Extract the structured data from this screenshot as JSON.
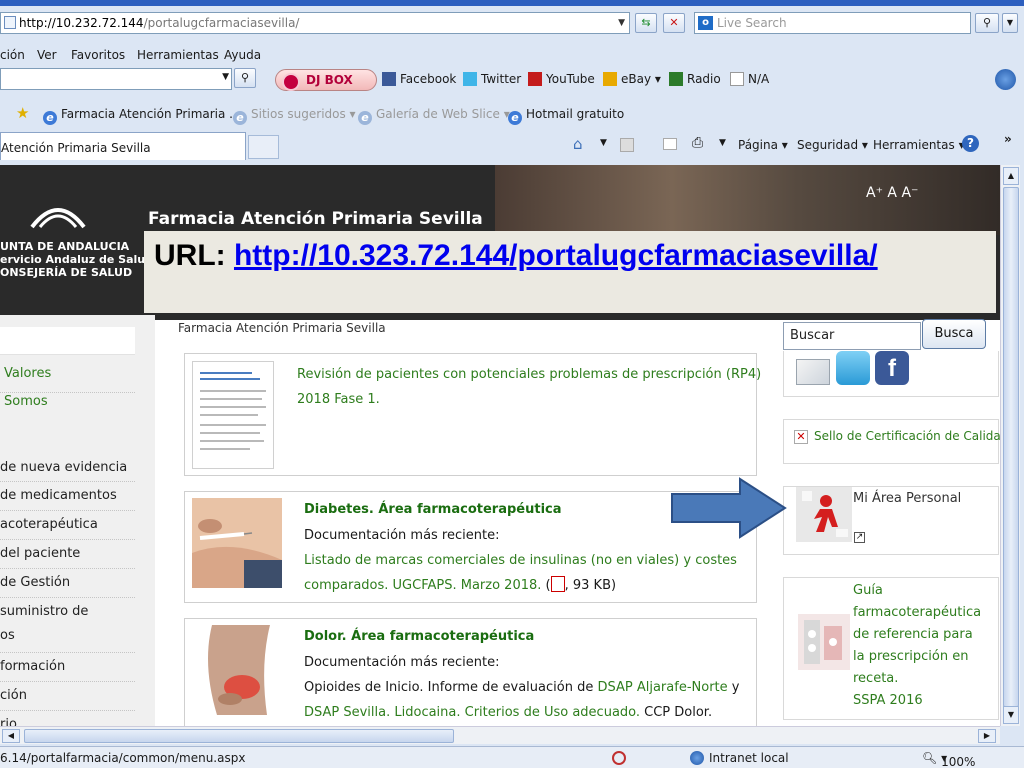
{
  "browser": {
    "address_host": "http://10.232.72.144",
    "address_path": "/portalugcfarmaciasevilla/",
    "live_search_placeholder": "Live Search",
    "menu": [
      "ción",
      "Ver",
      "Favoritos",
      "Herramientas",
      "Ayuda"
    ],
    "toolbar": {
      "djbox": "DJ BOX",
      "facebook": "Facebook",
      "twitter": "Twitter",
      "youtube": "YouTube",
      "ebay": "eBay",
      "radio": "Radio",
      "na": "N/A"
    },
    "favorites": [
      "Farmacia Atención Primaria ...",
      "Sitios sugeridos",
      "Galería de Web Slice",
      "Hotmail gratuito"
    ],
    "tab_title": "Atención Primaria Sevilla",
    "commands": [
      "Página",
      "Seguridad",
      "Herramientas"
    ],
    "status_url": "6.14/portalfarmacia/common/menu.aspx",
    "status_zone": "Intranet local",
    "status_zoom": "100%"
  },
  "banner": {
    "junta_lines": [
      "UNTA DE ANDALUCIA",
      "ervicio Andaluz de Salud",
      "ONSEJERÍA DE SALUD"
    ],
    "title": "Farmacia Atención Primaria Sevilla",
    "font_controls": "A⁺ A A⁻"
  },
  "overlay": {
    "label": "URL: ",
    "url": "http://10.323.72.144/portalugcfarmaciasevilla/"
  },
  "left_menu": {
    "items": [
      "Valores",
      "Somos",
      "de nueva evidencia",
      "de medicamentos",
      "acoterapéutica",
      "del paciente",
      "de Gestión",
      "suministro de",
      "os",
      "formación",
      "ción",
      "rio"
    ]
  },
  "breadcrumb": "Farmacia Atención Primaria Sevilla",
  "cards": [
    {
      "lines": [
        "Revisión de pacientes con potenciales problemas de prescripción (RP4)",
        "2018 Fase 1."
      ]
    },
    {
      "title": "Diabetes. Área farmacoterapéutica",
      "subtitle": "Documentación más reciente:",
      "link_line1": "Listado de marcas comerciales de insulinas (no en viales) y costes",
      "link_line2": "comparados. UGCFAPS. Marzo 2018.",
      "file_info": ", 93 KB)"
    },
    {
      "title": "Dolor. Área farmacoterapéutica",
      "subtitle": "Documentación más reciente:",
      "line1_text": "Opioides de Inicio. Informe de evaluación de ",
      "line1_link": "DSAP Aljarafe-Norte",
      "line1_tail": " y",
      "line2_link": "DSAP Sevilla. Lidocaina. Criterios de Uso adecuado.",
      "line2_tail": " CCP Dolor."
    }
  ],
  "right": {
    "search_value": "Buscar",
    "search_button": "Busca",
    "sello": "Sello de Certificación de Calidad d",
    "area_personal": "Mi Área Personal",
    "guide_lines": [
      "Guía",
      "farmacoterapéutica",
      "de referencia para",
      "la prescripción en",
      "receta.",
      "SSPA 2016"
    ]
  },
  "colors": {
    "green_link": "#2e7d1d",
    "arrow_fill": "#4a79b8",
    "banner_dark": "#2a2a2a"
  }
}
